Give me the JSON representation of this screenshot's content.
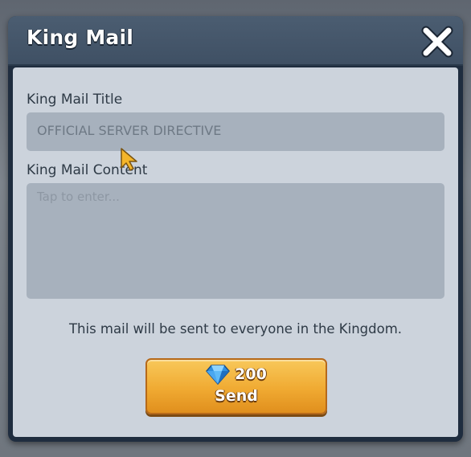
{
  "dialog": {
    "title": "King Mail",
    "close_icon": "close-x-icon"
  },
  "form": {
    "title_label": "King Mail Title",
    "title_value": "OFFICIAL SERVER DIRECTIVE",
    "content_label": "King Mail Content",
    "content_placeholder": "Tap to enter..."
  },
  "notice": "This mail will be sent to everyone in the Kingdom.",
  "send_button": {
    "cost_icon": "diamond-gem-icon",
    "cost": "200",
    "label": "Send"
  },
  "colors": {
    "header": "#44566a",
    "panel": "#ccd3dc",
    "field": "#a7b1bd",
    "button": "#f0aa32",
    "text": "#2e3a46"
  }
}
